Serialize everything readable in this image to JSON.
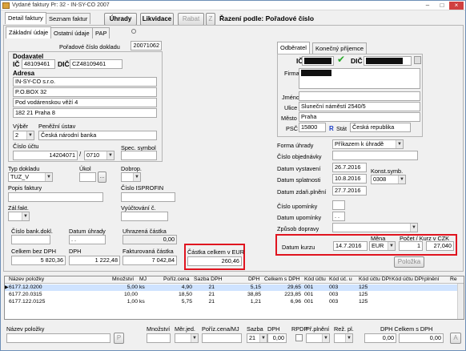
{
  "window": {
    "title": "Vydané faktury Pr: 32 - IN-SY-CO 2007",
    "minimize": "–",
    "maximize": "□",
    "close": "×"
  },
  "toolbar": {
    "tab_detail": "Detail faktury",
    "tab_seznam": "Seznam faktur",
    "uhrady": "Úhrady",
    "likvidace": "Likvidace",
    "rabat": "Rabat",
    "z": "Z",
    "sort_label": "Řazení podle: Pořadové číslo"
  },
  "subtabs": {
    "zakladni": "Základní údaje",
    "ostatni": "Ostatní údaje",
    "pap": "PAP"
  },
  "doc": {
    "poradove_label": "Pořadové číslo dokladu",
    "poradove_value": "20071062"
  },
  "dodavatel": {
    "header": "Dodavatel",
    "ic_label": "IČ",
    "ic_value": "48109461",
    "dic_label": "DIČ",
    "dic_value": "CZ48109461",
    "adresa_label": "Adresa",
    "address_lines": [
      "IN-SY-CO s.r.o.",
      "P.O.BOX 32",
      "Pod vodárenskou věží 4",
      "182 21 Praha 8"
    ]
  },
  "bank": {
    "vyber_label": "Výběr",
    "vyber_value": "2",
    "penezni_label": "Peněžní ústav",
    "penezni_value": "Česká národní banka",
    "cislo_uctu_label": "Číslo účtu",
    "cislo_uctu_value": "14204071",
    "kod_banky": "0710",
    "spec_symbol_label": "Spec. symbol"
  },
  "left_mid": {
    "typ_dokladu_label": "Typ dokladu",
    "typ_dokladu_value": "TUZ_V",
    "ukol_label": "Úkol",
    "dobrop_label": "Dobrop.",
    "popis_label": "Popis faktury",
    "cislo_isprofin_label": "Číslo ISPROFIN",
    "zal_fakt_label": "Zál.fakt.",
    "vyuctovani_label": "Vyúčtování č."
  },
  "totals": {
    "cislo_bank_dokl_label": "Číslo bank.dokl.",
    "datum_uhrady_label": "Datum úhrady",
    "datum_uhrady_value": ". .",
    "uhrazena_castka_label": "Uhrazená částka",
    "uhrazena_castka_value": "0,00",
    "celkem_bez_dph_label": "Celkem bez DPH",
    "celkem_bez_dph_value": "5 820,36",
    "dph_label": "DPH",
    "dph_value": "1 222,48",
    "fakturovana_label": "Fakturovaná částka",
    "fakturovana_value": "7 042,84",
    "castka_eur_label": "Částka celkem v EUR",
    "castka_eur_value": "260,46"
  },
  "odberatel": {
    "tab_odberatel": "Odběratel",
    "tab_konecny": "Konečný příjemce",
    "ic_label": "IČ",
    "dic_label": "DIČ",
    "firma_label": "Firma",
    "jmeno_label": "Jméno",
    "ulice_label": "Ulice",
    "ulice_value": "Sluneční náměstí 2540/5",
    "mesto_label": "Město",
    "mesto_value": "Praha",
    "psc_label": "PSČ",
    "psc_value": "15800",
    "r_label": "R",
    "stat_label": "Stát",
    "stat_value": "Česká republika"
  },
  "payment": {
    "forma_label": "Forma úhrady",
    "forma_value": "Příkazem k úhradě",
    "cislo_obj_label": "Číslo objednávky",
    "datum_vystaveni_label": "Datum vystavení",
    "datum_vystaveni_value": "26.7.2016",
    "konst_symb_label": "Konst.symb.",
    "konst_symb_value": "0308",
    "datum_splatnosti_label": "Datum splatnosti",
    "datum_splatnosti_value": "10.8.2016",
    "datum_zdan_label": "Datum zdaň.plnění",
    "datum_zdan_value": "27.7.2016",
    "cislo_upominky_label": "Číslo upomínky",
    "datum_upominky_label": "Datum upomínky",
    "datum_upominky_value": ". .",
    "zpusob_dopravy_label": "Způsob dopravy"
  },
  "kurz": {
    "datum_kurzu_label": "Datum kurzu",
    "datum_kurzu_value": "14.7.2016",
    "mena_label": "Měna",
    "mena_value": "EUR",
    "pocet_label": "Počet / Kurz v CZK",
    "pocet_value": "1",
    "kurz_value": "27,040",
    "polozka_button": "Položka"
  },
  "grid": {
    "columns": [
      "Název položky",
      "Množství",
      "MJ",
      "Poříz.cena",
      "Sazba DPH",
      "DPH",
      "Celkem s DPH",
      "Kód účtu",
      "Kód úč. u",
      "Kód účtu DPH",
      "Kód účtu DPH",
      "plnění",
      "Re"
    ],
    "rows": [
      [
        "6177.12.0200",
        "5,00",
        "ks",
        "4,90",
        "21",
        "5,15",
        "29,65",
        "001",
        "003",
        "125"
      ],
      [
        "6177.20.0315",
        "10,00",
        "",
        "18,50",
        "21",
        "38,85",
        "223,85",
        "001",
        "003",
        "125"
      ],
      [
        "6177.122.0125",
        "1,00",
        "ks",
        "5,75",
        "21",
        "1,21",
        "6,96",
        "001",
        "003",
        "125"
      ]
    ]
  },
  "bottom": {
    "nazev_label": "Název položky",
    "p_button": "P",
    "mnozstvi_label": "Množství",
    "mer_jed_label": "Měr.jed.",
    "poriz_label": "Poříz.cena/MJ",
    "sazba_label": "Sazba",
    "dph_label": "DPH",
    "rpdp_label": "RPDP",
    "pr_plneni_label": "Př.plnění",
    "rez_label": "Rež. pl.",
    "dph_celkem_label": "DPH Celkem s DPH",
    "a_button": "A",
    "sazba_value": "21",
    "dph_value": "0,00",
    "celkem_value": "0,00"
  },
  "colors": {
    "accent_red": "#e0141f",
    "window_border": "#6d8fb7",
    "selection": "#cfe3ff"
  }
}
